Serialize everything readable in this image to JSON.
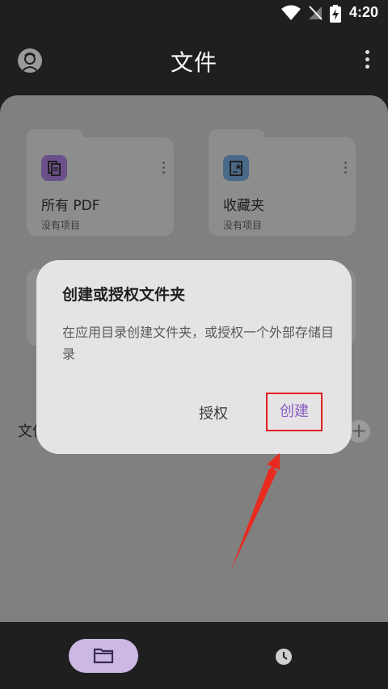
{
  "status_bar": {
    "time": "4:20"
  },
  "app_bar": {
    "title": "文件"
  },
  "folders": [
    {
      "name": "所有 PDF",
      "subtitle": "没有项目",
      "icon": "pdf-docs-icon",
      "color": "#6a4f8a"
    },
    {
      "name": "收藏夹",
      "subtitle": "没有项目",
      "icon": "star-doc-icon",
      "color": "#4a6a8a"
    }
  ],
  "section": {
    "label": "文件"
  },
  "dialog": {
    "title": "创建或授权文件夹",
    "message": "在应用目录创建文件夹，或授权一个外部存储目录",
    "secondary_button": "授权",
    "primary_button": "创建"
  },
  "colors": {
    "accent": "#8a5fc0",
    "highlight": "#e02020"
  }
}
